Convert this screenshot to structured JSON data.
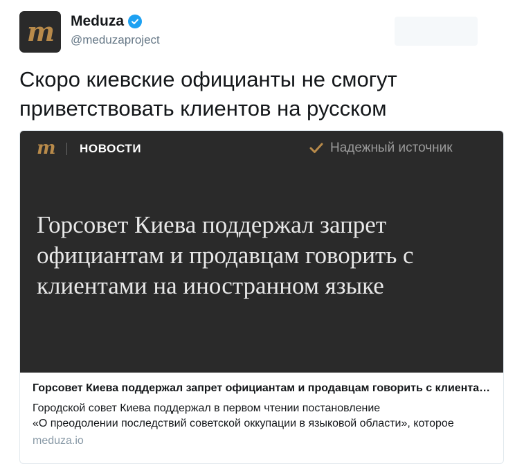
{
  "header": {
    "avatar_logo": "m",
    "name": "Meduza",
    "handle": "@meduzaproject",
    "verified_icon": "verified-badge-icon"
  },
  "tweet": {
    "text": "Скоро киевские официанты не смогут приветствовать клиентов на русском"
  },
  "card": {
    "image": {
      "logo": "m",
      "section": "НОВОСТИ",
      "check_icon": "checkmark-icon",
      "source_label": "Надежный источник",
      "headline": "Горсовет Киева поддержал запрет официантам и продавцам говорить с клиентами на иностранном языке"
    },
    "title": "Горсовет Киева поддержал запрет официантам и продавцам говорить с клиентами на иностранном языке",
    "description_line1": "Городской совет Киева поддержал в первом чтении постановление",
    "description_line2": "«О преодолении последствий советской оккупации в языковой области», которое",
    "domain": "meduza.io"
  },
  "colors": {
    "brand_gold": "#b88a4a",
    "card_dark": "#2a2a2a",
    "verified_blue": "#1da1f2"
  }
}
